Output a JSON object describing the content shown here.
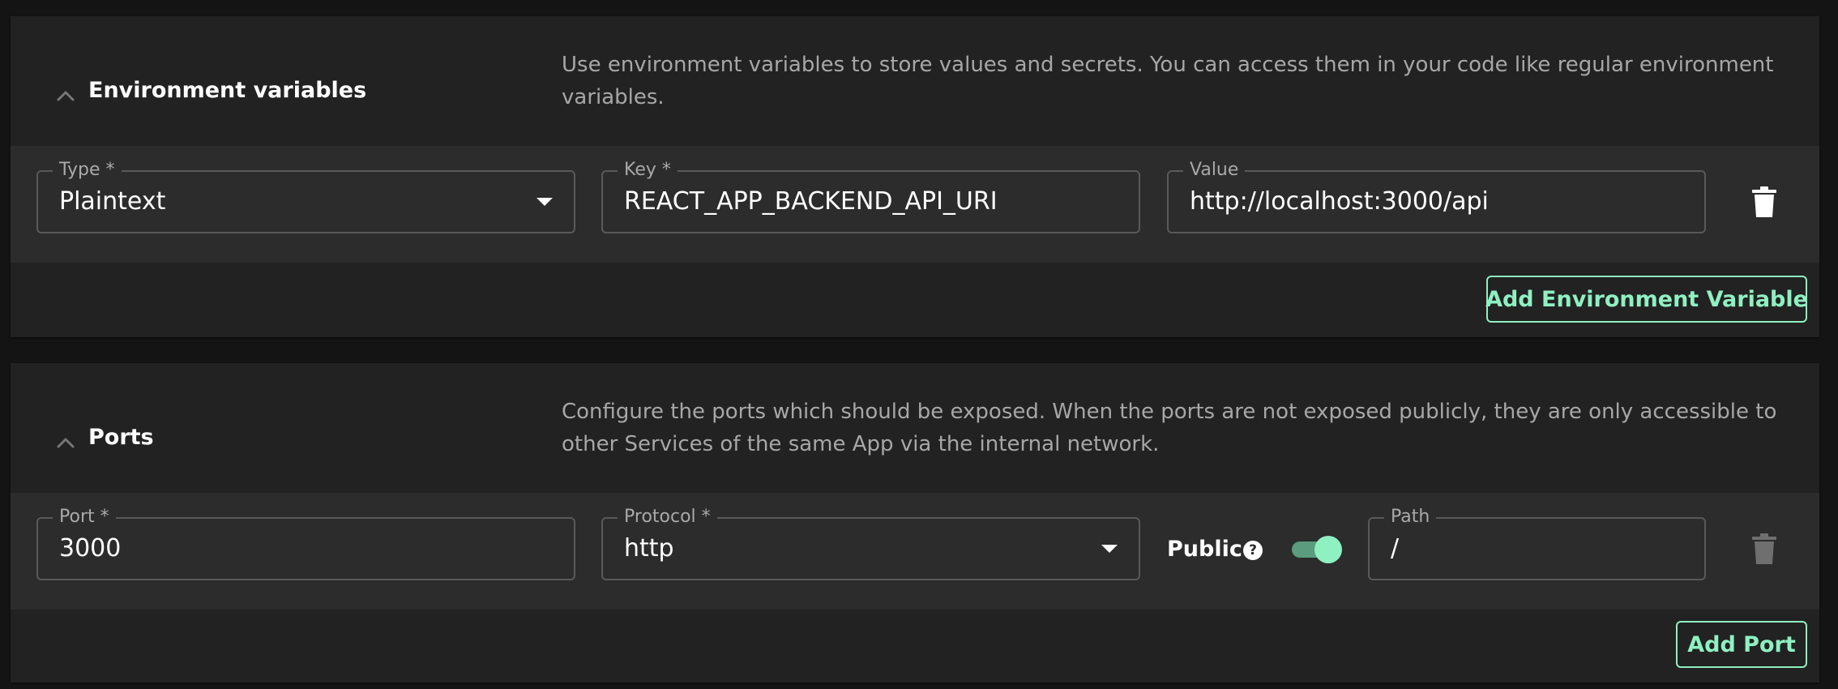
{
  "env_section": {
    "title": "Environment variables",
    "description": "Use environment variables to store values and secrets. You can access them in your code like regular environment variables.",
    "row": {
      "type_label": "Type *",
      "type_value": "Plaintext",
      "key_label": "Key *",
      "key_value": "REACT_APP_BACKEND_API_URI",
      "value_label": "Value",
      "value_value": "http://localhost:3000/api"
    },
    "add_button_label": "Add Environment Variable"
  },
  "ports_section": {
    "title": "Ports",
    "description": "Configure the ports which should be exposed. When the ports are not exposed publicly, they are only accessible to other Services of the same App via the internal network.",
    "row": {
      "port_label": "Port *",
      "port_value": "3000",
      "protocol_label": "Protocol *",
      "protocol_value": "http",
      "public_label": "Public",
      "public_help": "?",
      "public_enabled": true,
      "path_label": "Path",
      "path_value": "/"
    },
    "add_button_label": "Add Port"
  },
  "colors": {
    "accent": "#8ff0c2",
    "card_background": "#222222",
    "row_background": "#2b2c2b",
    "page_background": "#141414"
  },
  "icons": {
    "collapse": "chevron-up-icon",
    "delete": "trash-icon",
    "dropdown": "caret-down-icon",
    "help": "question-circle-icon"
  }
}
